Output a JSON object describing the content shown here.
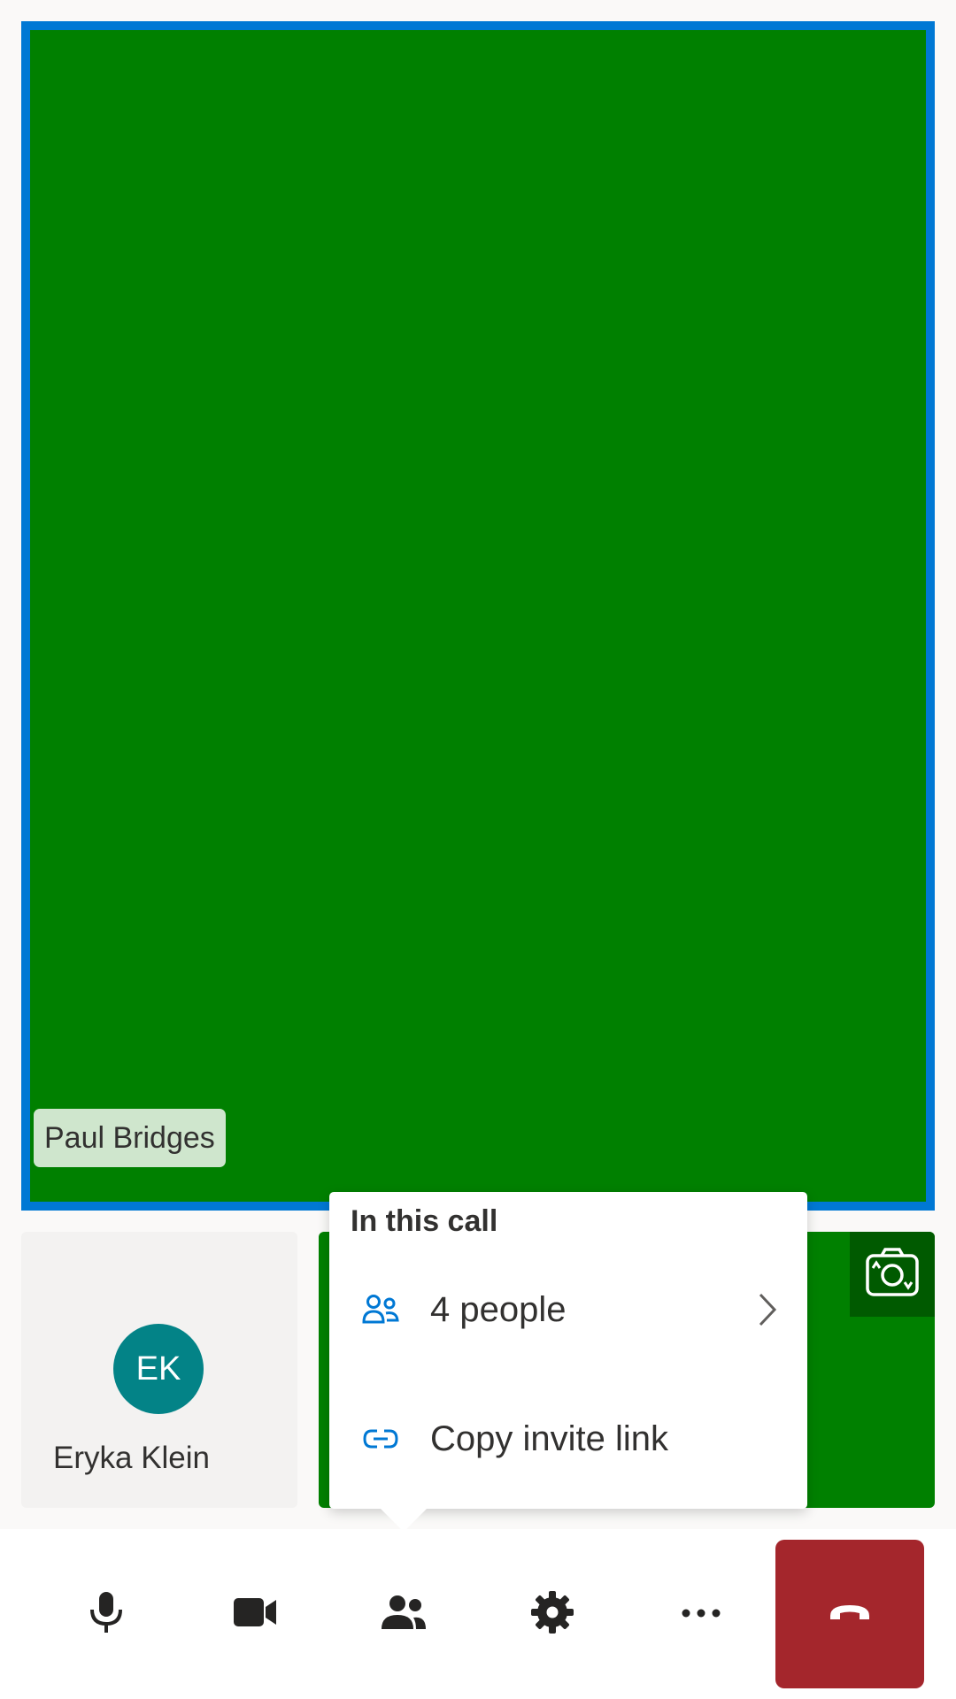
{
  "colors": {
    "accent": "#0078d4",
    "video_green": "#008000",
    "avatar_teal": "#038387",
    "hangup_red": "#a4262c"
  },
  "main_video": {
    "participant_name": "Paul Bridges"
  },
  "tiles": [
    {
      "initials": "EK",
      "name": "Eryka Klein"
    }
  ],
  "popup": {
    "title": "In this call",
    "items": [
      {
        "label": "4 people",
        "icon": "people-icon",
        "chevron": "chevron-right-icon"
      },
      {
        "label": "Copy invite link",
        "icon": "link-icon"
      }
    ]
  },
  "controls": [
    {
      "name": "microphone",
      "icon": "microphone-icon"
    },
    {
      "name": "camera",
      "icon": "video-camera-icon"
    },
    {
      "name": "people",
      "icon": "people-icon"
    },
    {
      "name": "settings",
      "icon": "gear-icon"
    },
    {
      "name": "more",
      "icon": "more-icon"
    },
    {
      "name": "end-call",
      "icon": "phone-hangup-icon"
    }
  ]
}
